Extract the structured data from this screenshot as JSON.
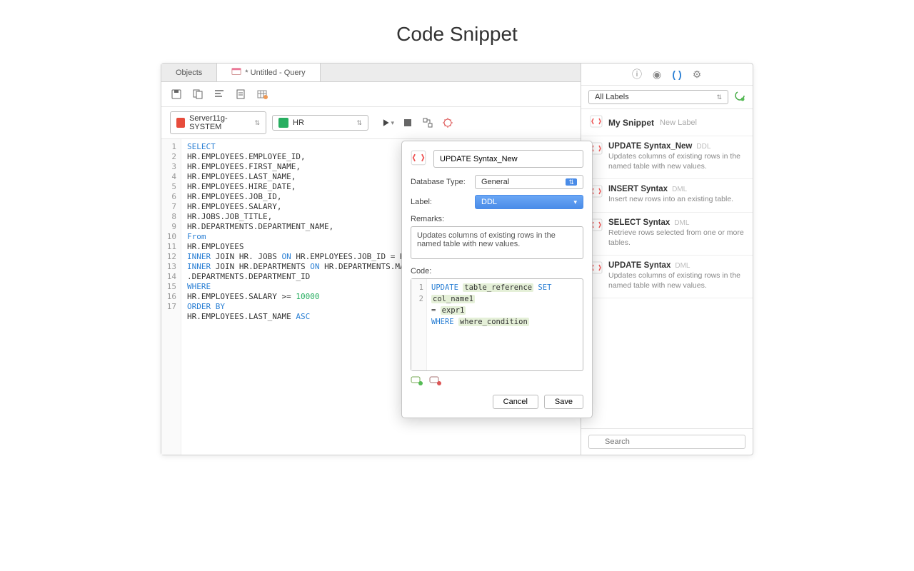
{
  "page_heading": "Code Snippet",
  "tabs": {
    "objects": "Objects",
    "query": "* Untitled - Query"
  },
  "connection": {
    "server": "Server11g-SYSTEM",
    "database": "HR"
  },
  "editor_lines": [
    "1",
    "2",
    "3",
    "4",
    "5",
    "6",
    "7",
    "8",
    "9",
    "10",
    "11",
    "12",
    "13",
    "14",
    "15",
    "16",
    "17"
  ],
  "sql": {
    "l1": "SELECT",
    "l2": "HR.EMPLOYEES.EMPLOYEE_ID,",
    "l3": "HR.EMPLOYEES.FIRST_NAME,",
    "l4": "HR.EMPLOYEES.LAST_NAME,",
    "l5": "HR.EMPLOYEES.HIRE_DATE,",
    "l6": "HR.EMPLOYEES.JOB_ID,",
    "l7": "HR.EMPLOYEES.SALARY,",
    "l8": "HR.JOBS.JOB_TITLE,",
    "l9": "HR.DEPARTMENTS.DEPARTMENT_NAME,",
    "l10": "From",
    "l11": "HR.EMPLOYEES",
    "l12a": "INNER",
    "l12b": " JOIN HR. JOBS ",
    "l12c": "ON",
    "l12d": " HR.EMPLOYEES.JOB_ID = HR.JOBS.JOB",
    "l13a": "INNER",
    "l13b": " JOIN HR.DEPARTMENTS ",
    "l13c": "ON",
    "l13d": " HR.DEPARTMENTS.MANAGER",
    "l13e": ".DEPARTMENTS.DEPARTMENT_ID",
    "l14": "WHERE",
    "l15a": "HR.EMPLOYEES.SALARY >= ",
    "l15b": "10000",
    "l16": "ORDER BY",
    "l17a": "HR.EMPLOYEES.LAST_NAME ",
    "l17b": "ASC"
  },
  "dialog": {
    "name": "UPDATE Syntax_New",
    "db_type_label": "Database Type:",
    "db_type_value": "General",
    "label_label": "Label:",
    "label_value": "DDL",
    "remarks_label": "Remarks:",
    "remarks_text": "Updates columns of existing rows in the named table with new values.",
    "code_label": "Code:",
    "code": {
      "kw_update": "UPDATE",
      "ph_table": "table_reference",
      "kw_set": "SET",
      "ph_col": "col_name1",
      "eq": " = ",
      "ph_expr": "expr1",
      "kw_where": "WHERE",
      "ph_where": "where_condition"
    },
    "cancel": "Cancel",
    "save": "Save"
  },
  "side": {
    "labels_dd": "All Labels",
    "my_snippet": "My Snippet",
    "new_label": "New Label",
    "items": [
      {
        "title": "UPDATE Syntax_New",
        "tag": "DDL",
        "desc": "Updates columns of existing rows in the named table with new values."
      },
      {
        "title": "INSERT Syntax",
        "tag": "DML",
        "desc": "Insert new rows into an existing table."
      },
      {
        "title": "SELECT Syntax",
        "tag": "DML",
        "desc": "Retrieve rows selected from one or more tables."
      },
      {
        "title": "UPDATE Syntax",
        "tag": "DML",
        "desc": "Updates columns of existing rows in the named table with new values."
      }
    ],
    "search_placeholder": "Search"
  }
}
